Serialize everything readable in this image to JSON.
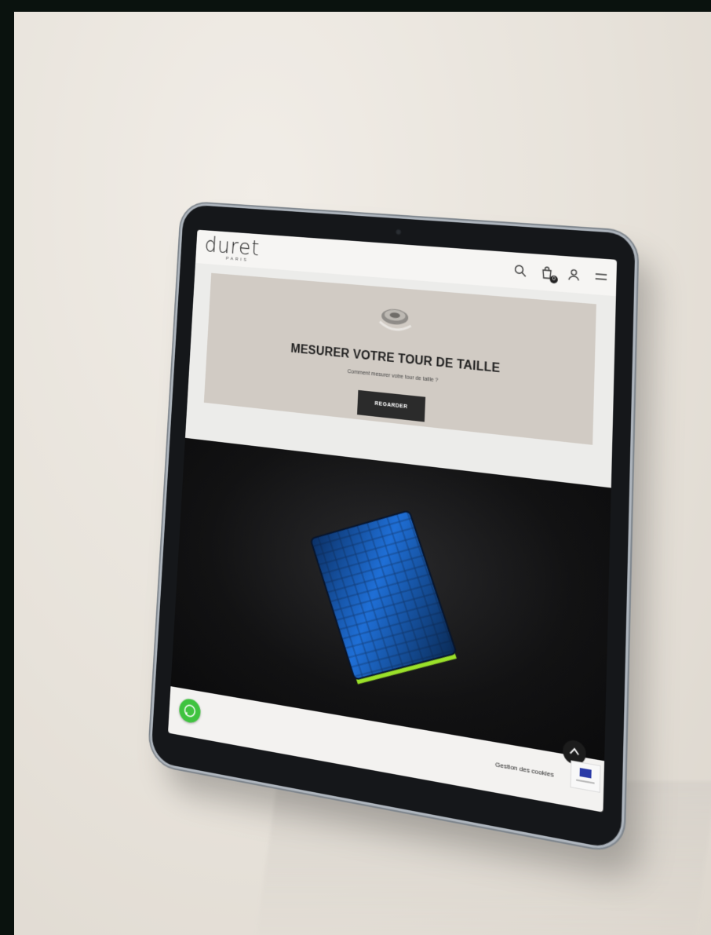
{
  "brand": {
    "logo_text": "duret",
    "logo_sub": "PARIS"
  },
  "header": {
    "icons": [
      "search-icon",
      "cart-icon",
      "account-icon",
      "menu-icon"
    ],
    "cart_count": "0"
  },
  "promo": {
    "title": "MESURER VOTRE TOUR DE TAILLE",
    "subtitle": "Comment mesurer votre tour de taille ?",
    "button_label": "REGARDER"
  },
  "footer": {
    "cookies_label": "Gestion des cookies"
  },
  "colors": {
    "brand_dark": "#2b2b2b",
    "promo_bg": "#d1cbc4",
    "whatsapp": "#3fc33f",
    "wallet_blue": "#1f6fd6",
    "wallet_lime": "#9be12a"
  }
}
